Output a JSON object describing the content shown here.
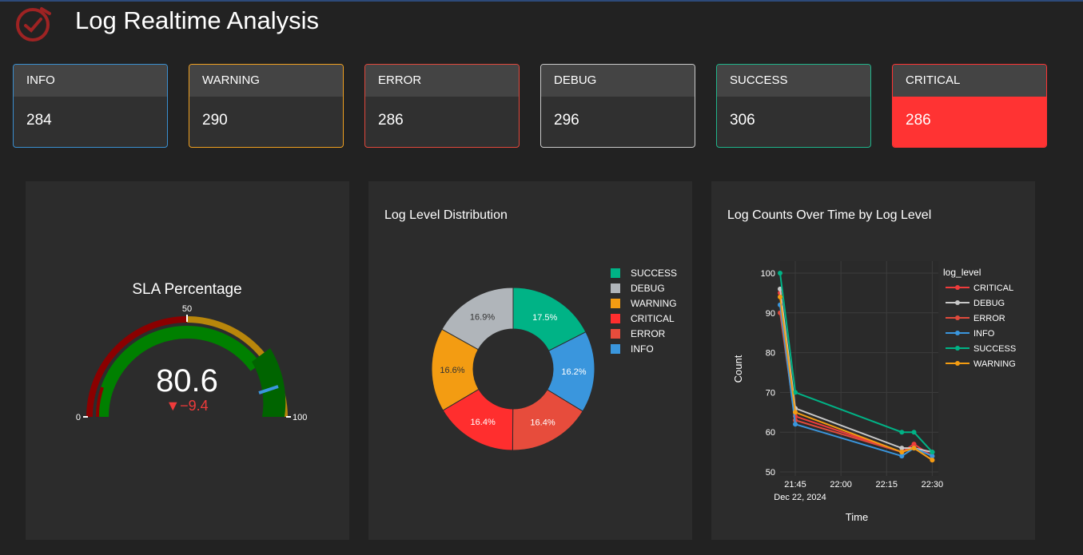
{
  "header": {
    "title": "Log Realtime Analysis",
    "logo_icon": "clock-check-icon",
    "accent": "#b52a2a"
  },
  "cards": [
    {
      "label": "INFO",
      "value": "284",
      "border": "#3a8fd0",
      "fill": ""
    },
    {
      "label": "WARNING",
      "value": "290",
      "border": "#f0a020",
      "fill": ""
    },
    {
      "label": "ERROR",
      "value": "286",
      "border": "#e0483c",
      "fill": ""
    },
    {
      "label": "DEBUG",
      "value": "296",
      "border": "#c9c9c9",
      "fill": ""
    },
    {
      "label": "SUCCESS",
      "value": "306",
      "border": "#1fb48a",
      "fill": ""
    },
    {
      "label": "CRITICAL",
      "value": "286",
      "border": "#ff3333",
      "fill": "#ff3333"
    }
  ],
  "gauge": {
    "title": "SLA Percentage",
    "value": "80.6",
    "delta": "▼−9.4",
    "tick_min": "0",
    "tick_mid": "50",
    "tick_max": "100"
  },
  "chart_data": [
    {
      "type": "pie",
      "title": "Log Level Distribution",
      "hole": true,
      "legend_position": "right",
      "series": [
        {
          "name": "SUCCESS",
          "pct_label": "17.5%",
          "value": 17.5,
          "color": "#00b386"
        },
        {
          "name": "INFO",
          "pct_label": "16.2%",
          "value": 16.2,
          "color": "#3a96dd"
        },
        {
          "name": "ERROR",
          "pct_label": "16.4%",
          "value": 16.4,
          "color": "#e74c3c"
        },
        {
          "name": "CRITICAL",
          "pct_label": "16.4%",
          "value": 16.4,
          "color": "#ff2e2e"
        },
        {
          "name": "WARNING",
          "pct_label": "16.6%",
          "value": 16.6,
          "color": "#f39c12"
        },
        {
          "name": "DEBUG",
          "pct_label": "16.9%",
          "value": 16.9,
          "color": "#b0b5ba"
        }
      ],
      "legend_order": [
        "SUCCESS",
        "DEBUG",
        "WARNING",
        "CRITICAL",
        "ERROR",
        "INFO"
      ]
    },
    {
      "type": "line",
      "title": "Log Counts Over Time by Log Level",
      "xlabel": "Time",
      "ylabel": "Count",
      "legend_title": "log_level",
      "ylim": [
        49,
        103
      ],
      "xlim": [
        "21:40",
        "22:32"
      ],
      "xticks": [
        "21:45",
        "22:00",
        "22:15",
        "22:30"
      ],
      "xtick_sub": "Dec 22, 2024",
      "yticks": [
        50,
        60,
        70,
        80,
        90,
        100
      ],
      "grid": true,
      "series": [
        {
          "name": "CRITICAL",
          "color": "#ef3b3b",
          "points": [
            [
              "21:40",
              95
            ],
            [
              "21:45",
              64
            ],
            [
              "22:20",
              55
            ],
            [
              "22:24",
              57
            ],
            [
              "22:30",
              54
            ]
          ]
        },
        {
          "name": "DEBUG",
          "color": "#c8c8c8",
          "points": [
            [
              "21:40",
              96
            ],
            [
              "21:45",
              66
            ],
            [
              "22:20",
              56
            ],
            [
              "22:24",
              56
            ],
            [
              "22:30",
              55
            ]
          ]
        },
        {
          "name": "ERROR",
          "color": "#e04a3c",
          "points": [
            [
              "21:40",
              90
            ],
            [
              "21:45",
              63
            ],
            [
              "22:20",
              55
            ],
            [
              "22:24",
              56
            ],
            [
              "22:30",
              53
            ]
          ]
        },
        {
          "name": "INFO",
          "color": "#3a96dd",
          "points": [
            [
              "21:40",
              92
            ],
            [
              "21:45",
              62
            ],
            [
              "22:20",
              54
            ],
            [
              "22:24",
              56
            ],
            [
              "22:30",
              54
            ]
          ]
        },
        {
          "name": "SUCCESS",
          "color": "#00b386",
          "points": [
            [
              "21:40",
              100
            ],
            [
              "21:45",
              70
            ],
            [
              "22:20",
              60
            ],
            [
              "22:24",
              60
            ],
            [
              "22:30",
              55
            ]
          ]
        },
        {
          "name": "WARNING",
          "color": "#f39c12",
          "points": [
            [
              "21:40",
              94
            ],
            [
              "21:45",
              65
            ],
            [
              "22:20",
              55
            ],
            [
              "22:24",
              56
            ],
            [
              "22:30",
              53
            ]
          ]
        }
      ]
    }
  ]
}
